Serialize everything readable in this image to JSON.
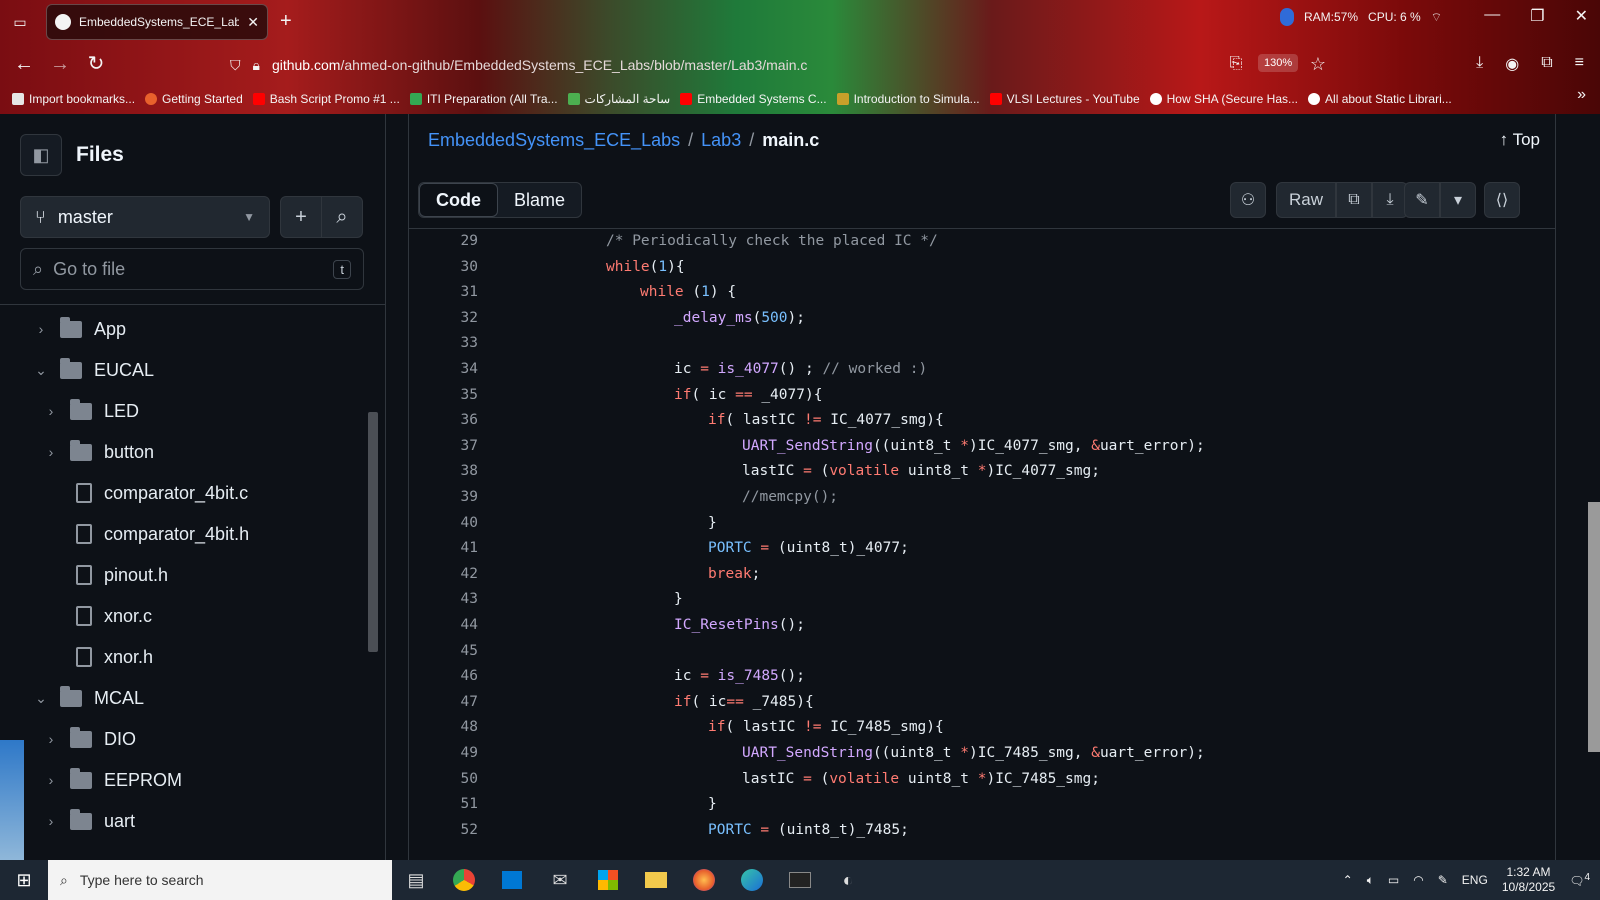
{
  "browser": {
    "tab_title": "EmbeddedSystems_ECE_Labs/L",
    "tab_close": "✕",
    "new_tab": "+",
    "sysmon": {
      "ram": "RAM:57%",
      "cpu": "CPU: 6 %"
    },
    "url_host": "github.com",
    "url_path": "/ahmed-on-github/EmbeddedSystems_ECE_Labs/blob/master/Lab3/main.c",
    "zoom": "130%",
    "bookmarks": [
      {
        "label": "Import bookmarks...",
        "color": "#e6e6e6"
      },
      {
        "label": "Getting Started",
        "color": "#e8612c"
      },
      {
        "label": "Bash Script Promo #1 ...",
        "color": "#ff0000"
      },
      {
        "label": "ITI Preparation (All Tra...",
        "color": "#34a853"
      },
      {
        "label": "ساحة المشاركات",
        "color": "#4caf50"
      },
      {
        "label": "Embedded Systems C...",
        "color": "#ff0000"
      },
      {
        "label": "Introduction to Simula...",
        "color": "#c8a02a"
      },
      {
        "label": "VLSI Lectures - YouTube",
        "color": "#ff0000"
      },
      {
        "label": "How SHA (Secure Has...",
        "color": "#ffffff"
      },
      {
        "label": "All about Static Librari...",
        "color": "#ffffff"
      }
    ]
  },
  "sidebar": {
    "title": "Files",
    "branch": "master",
    "search_placeholder": "Go to file",
    "search_key": "t",
    "tree": [
      {
        "label": "App",
        "type": "folder",
        "expanded": false,
        "depth": 0
      },
      {
        "label": "EUCAL",
        "type": "folder",
        "expanded": true,
        "depth": 0
      },
      {
        "label": "LED",
        "type": "folder",
        "expanded": false,
        "depth": 1
      },
      {
        "label": "button",
        "type": "folder",
        "expanded": false,
        "depth": 1
      },
      {
        "label": "comparator_4bit.c",
        "type": "file",
        "depth": 1
      },
      {
        "label": "comparator_4bit.h",
        "type": "file",
        "depth": 1
      },
      {
        "label": "pinout.h",
        "type": "file",
        "depth": 1
      },
      {
        "label": "xnor.c",
        "type": "file",
        "depth": 1
      },
      {
        "label": "xnor.h",
        "type": "file",
        "depth": 1
      },
      {
        "label": "MCAL",
        "type": "folder",
        "expanded": true,
        "depth": 0
      },
      {
        "label": "DIO",
        "type": "folder",
        "expanded": false,
        "depth": 1
      },
      {
        "label": "EEPROM",
        "type": "folder",
        "expanded": false,
        "depth": 1
      },
      {
        "label": "uart",
        "type": "folder",
        "expanded": false,
        "depth": 1
      }
    ]
  },
  "main": {
    "breadcrumb": {
      "repo": "EmbeddedSystems_ECE_Labs",
      "dir": "Lab3",
      "file": "main.c",
      "sep": "/"
    },
    "top_label": "Top",
    "tabs": {
      "code": "Code",
      "blame": "Blame"
    },
    "raw_label": "Raw",
    "code_lines": [
      {
        "n": "29",
        "indent": 8,
        "tokens": [
          [
            "/* Periodically check the placed IC */",
            "#9198a1"
          ]
        ]
      },
      {
        "n": "30",
        "indent": 8,
        "tokens": [
          [
            "while",
            "#ff7b72"
          ],
          [
            "(",
            "#e6edf3"
          ],
          [
            "1",
            "#79c0ff"
          ],
          [
            "){",
            "#e6edf3"
          ]
        ]
      },
      {
        "n": "31",
        "indent": 12,
        "tokens": [
          [
            "while",
            "#ff7b72"
          ],
          [
            " (",
            "#e6edf3"
          ],
          [
            "1",
            "#79c0ff"
          ],
          [
            ") {",
            "#e6edf3"
          ]
        ]
      },
      {
        "n": "32",
        "indent": 16,
        "tokens": [
          [
            "_delay_ms",
            "#d2a8ff"
          ],
          [
            "(",
            "#e6edf3"
          ],
          [
            "500",
            "#79c0ff"
          ],
          [
            ");",
            "#e6edf3"
          ]
        ]
      },
      {
        "n": "33",
        "indent": 0,
        "tokens": []
      },
      {
        "n": "34",
        "indent": 16,
        "tokens": [
          [
            "ic ",
            "#e6edf3"
          ],
          [
            "=",
            "#ff7b72"
          ],
          [
            " ",
            "#e6edf3"
          ],
          [
            "is_4077",
            "#d2a8ff"
          ],
          [
            "() ; ",
            "#e6edf3"
          ],
          [
            "// worked :)",
            "#9198a1"
          ]
        ]
      },
      {
        "n": "35",
        "indent": 16,
        "tokens": [
          [
            "if",
            "#ff7b72"
          ],
          [
            "( ic ",
            "#e6edf3"
          ],
          [
            "==",
            "#ff7b72"
          ],
          [
            " _4077){",
            "#e6edf3"
          ]
        ]
      },
      {
        "n": "36",
        "indent": 20,
        "tokens": [
          [
            "if",
            "#ff7b72"
          ],
          [
            "( lastIC ",
            "#e6edf3"
          ],
          [
            "!=",
            "#ff7b72"
          ],
          [
            " IC_4077_smg){",
            "#e6edf3"
          ]
        ]
      },
      {
        "n": "37",
        "indent": 24,
        "tokens": [
          [
            "UART_SendString",
            "#d2a8ff"
          ],
          [
            "((uint8_t ",
            "#e6edf3"
          ],
          [
            "*",
            "#ff7b72"
          ],
          [
            ")IC_4077_smg, ",
            "#e6edf3"
          ],
          [
            "&",
            "#ff7b72"
          ],
          [
            "uart_error);",
            "#e6edf3"
          ]
        ]
      },
      {
        "n": "38",
        "indent": 24,
        "tokens": [
          [
            "lastIC ",
            "#e6edf3"
          ],
          [
            "=",
            "#ff7b72"
          ],
          [
            " (",
            "#e6edf3"
          ],
          [
            "volatile",
            "#ff7b72"
          ],
          [
            " uint8_t ",
            "#e6edf3"
          ],
          [
            "*",
            "#ff7b72"
          ],
          [
            ")IC_4077_smg;",
            "#e6edf3"
          ]
        ]
      },
      {
        "n": "39",
        "indent": 24,
        "tokens": [
          [
            "//memcpy();",
            "#9198a1"
          ]
        ]
      },
      {
        "n": "40",
        "indent": 20,
        "tokens": [
          [
            "}",
            "#e6edf3"
          ]
        ]
      },
      {
        "n": "41",
        "indent": 20,
        "tokens": [
          [
            "PORTC",
            "#79c0ff"
          ],
          [
            " ",
            "#e6edf3"
          ],
          [
            "=",
            "#ff7b72"
          ],
          [
            " (uint8_t)_4077;",
            "#e6edf3"
          ]
        ]
      },
      {
        "n": "42",
        "indent": 20,
        "tokens": [
          [
            "break",
            "#ff7b72"
          ],
          [
            ";",
            "#e6edf3"
          ]
        ]
      },
      {
        "n": "43",
        "indent": 16,
        "tokens": [
          [
            "}",
            "#e6edf3"
          ]
        ]
      },
      {
        "n": "44",
        "indent": 16,
        "tokens": [
          [
            "IC_ResetPins",
            "#d2a8ff"
          ],
          [
            "();",
            "#e6edf3"
          ]
        ]
      },
      {
        "n": "45",
        "indent": 0,
        "tokens": []
      },
      {
        "n": "46",
        "indent": 16,
        "tokens": [
          [
            "ic ",
            "#e6edf3"
          ],
          [
            "=",
            "#ff7b72"
          ],
          [
            " ",
            "#e6edf3"
          ],
          [
            "is_7485",
            "#d2a8ff"
          ],
          [
            "();",
            "#e6edf3"
          ]
        ]
      },
      {
        "n": "47",
        "indent": 16,
        "tokens": [
          [
            "if",
            "#ff7b72"
          ],
          [
            "( ic",
            "#e6edf3"
          ],
          [
            "==",
            "#ff7b72"
          ],
          [
            " _7485){",
            "#e6edf3"
          ]
        ]
      },
      {
        "n": "48",
        "indent": 20,
        "tokens": [
          [
            "if",
            "#ff7b72"
          ],
          [
            "( lastIC ",
            "#e6edf3"
          ],
          [
            "!=",
            "#ff7b72"
          ],
          [
            " IC_7485_smg){",
            "#e6edf3"
          ]
        ]
      },
      {
        "n": "49",
        "indent": 24,
        "tokens": [
          [
            "UART_SendString",
            "#d2a8ff"
          ],
          [
            "((uint8_t ",
            "#e6edf3"
          ],
          [
            "*",
            "#ff7b72"
          ],
          [
            ")IC_7485_smg, ",
            "#e6edf3"
          ],
          [
            "&",
            "#ff7b72"
          ],
          [
            "uart_error);",
            "#e6edf3"
          ]
        ]
      },
      {
        "n": "50",
        "indent": 24,
        "tokens": [
          [
            "lastIC ",
            "#e6edf3"
          ],
          [
            "=",
            "#ff7b72"
          ],
          [
            " (",
            "#e6edf3"
          ],
          [
            "volatile",
            "#ff7b72"
          ],
          [
            " uint8_t ",
            "#e6edf3"
          ],
          [
            "*",
            "#ff7b72"
          ],
          [
            ")IC_7485_smg;",
            "#e6edf3"
          ]
        ]
      },
      {
        "n": "51",
        "indent": 20,
        "tokens": [
          [
            "}",
            "#e6edf3"
          ]
        ]
      },
      {
        "n": "52",
        "indent": 20,
        "tokens": [
          [
            "PORTC",
            "#79c0ff"
          ],
          [
            " ",
            "#e6edf3"
          ],
          [
            "=",
            "#ff7b72"
          ],
          [
            " (uint8_t)_7485;",
            "#e6edf3"
          ]
        ]
      }
    ]
  },
  "taskbar": {
    "search_placeholder": "Type here to search",
    "lang": "ENG",
    "time": "1:32 AM",
    "date": "10/8/2025",
    "notif_count": "4"
  },
  "colors": {
    "link": "#4493f8",
    "bg": "#0d1117",
    "border": "#30363d"
  }
}
